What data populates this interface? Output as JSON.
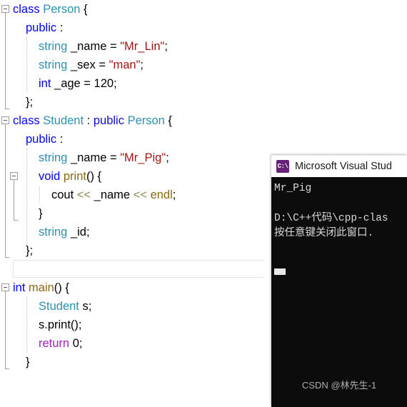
{
  "editor": {
    "language": "cpp",
    "lines": [
      {
        "indent": 0,
        "fold": "root-open",
        "tokens": [
          {
            "t": "class",
            "c": "kw"
          },
          {
            "t": " ",
            "c": "plain"
          },
          {
            "t": "Person",
            "c": "type"
          },
          {
            "t": " {",
            "c": "brace"
          }
        ]
      },
      {
        "indent": 1,
        "tokens": [
          {
            "t": "public",
            "c": "kw"
          },
          {
            "t": " :",
            "c": "plain"
          }
        ]
      },
      {
        "indent": 2,
        "tokens": [
          {
            "t": "string",
            "c": "type"
          },
          {
            "t": " _name = ",
            "c": "plain"
          },
          {
            "t": "\"Mr_Lin\"",
            "c": "str"
          },
          {
            "t": ";",
            "c": "plain"
          }
        ]
      },
      {
        "indent": 2,
        "tokens": [
          {
            "t": "string",
            "c": "type"
          },
          {
            "t": " _sex = ",
            "c": "plain"
          },
          {
            "t": "\"man\"",
            "c": "str"
          },
          {
            "t": ";",
            "c": "plain"
          }
        ]
      },
      {
        "indent": 2,
        "tokens": [
          {
            "t": "int",
            "c": "kw"
          },
          {
            "t": " _age = ",
            "c": "plain"
          },
          {
            "t": "120",
            "c": "num"
          },
          {
            "t": ";",
            "c": "plain"
          }
        ]
      },
      {
        "indent": 1,
        "tokens": [
          {
            "t": "};",
            "c": "brace"
          }
        ]
      },
      {
        "indent": 0,
        "fold": "root-open",
        "tokens": [
          {
            "t": "class",
            "c": "kw"
          },
          {
            "t": " ",
            "c": "plain"
          },
          {
            "t": "Student",
            "c": "type"
          },
          {
            "t": " : ",
            "c": "plain"
          },
          {
            "t": "public",
            "c": "kw2"
          },
          {
            "t": " ",
            "c": "plain"
          },
          {
            "t": "Person",
            "c": "type"
          },
          {
            "t": " {",
            "c": "brace"
          }
        ]
      },
      {
        "indent": 1,
        "tokens": [
          {
            "t": "public",
            "c": "kw"
          },
          {
            "t": " :",
            "c": "plain"
          }
        ]
      },
      {
        "indent": 2,
        "tokens": [
          {
            "t": "string",
            "c": "type"
          },
          {
            "t": " _name = ",
            "c": "plain"
          },
          {
            "t": "\"Mr_Pig\"",
            "c": "str"
          },
          {
            "t": ";",
            "c": "plain"
          }
        ]
      },
      {
        "indent": 2,
        "fold": "nested-open",
        "tokens": [
          {
            "t": "void",
            "c": "kw"
          },
          {
            "t": " ",
            "c": "plain"
          },
          {
            "t": "print",
            "c": "fn"
          },
          {
            "t": "() {",
            "c": "brace"
          }
        ]
      },
      {
        "indent": 3,
        "tokens": [
          {
            "t": "cout ",
            "c": "plain"
          },
          {
            "t": "<<",
            "c": "op"
          },
          {
            "t": " _name ",
            "c": "plain"
          },
          {
            "t": "<<",
            "c": "op"
          },
          {
            "t": " ",
            "c": "plain"
          },
          {
            "t": "endl",
            "c": "fn"
          },
          {
            "t": ";",
            "c": "plain"
          }
        ]
      },
      {
        "indent": 2,
        "tokens": [
          {
            "t": "}",
            "c": "brace"
          }
        ]
      },
      {
        "indent": 2,
        "tokens": [
          {
            "t": "string",
            "c": "type"
          },
          {
            "t": " _id;",
            "c": "plain"
          }
        ]
      },
      {
        "indent": 1,
        "tokens": [
          {
            "t": "};",
            "c": "brace"
          }
        ]
      },
      {
        "indent": 1,
        "blank": true,
        "current": true,
        "tokens": []
      },
      {
        "indent": 0,
        "fold": "root-open",
        "tokens": [
          {
            "t": "int",
            "c": "kw"
          },
          {
            "t": " ",
            "c": "plain"
          },
          {
            "t": "main",
            "c": "fn"
          },
          {
            "t": "() {",
            "c": "brace"
          }
        ]
      },
      {
        "indent": 2,
        "tokens": [
          {
            "t": "Student",
            "c": "type"
          },
          {
            "t": " s;",
            "c": "plain"
          }
        ]
      },
      {
        "indent": 2,
        "tokens": [
          {
            "t": "s.print();",
            "c": "plain"
          }
        ]
      },
      {
        "indent": 2,
        "tokens": [
          {
            "t": "return",
            "c": "ctrl"
          },
          {
            "t": " ",
            "c": "plain"
          },
          {
            "t": "0",
            "c": "num"
          },
          {
            "t": ";",
            "c": "plain"
          }
        ]
      },
      {
        "indent": 1,
        "tokens": [
          {
            "t": "}",
            "c": "brace"
          }
        ]
      }
    ]
  },
  "console": {
    "icon_glyph": "C:\\",
    "icon_name": "visual-studio-console-icon",
    "title": "Microsoft Visual Stud",
    "lines": [
      "Mr_Pig",
      "",
      "D:\\C++代码\\cpp-clas",
      "按任意键关闭此窗口."
    ],
    "watermark": "CSDN @林先生-1"
  },
  "colors": {
    "keyword": "#0000FF",
    "type": "#2B91AF",
    "string": "#A31515",
    "function": "#8B6914",
    "control": "#A020C0",
    "operator": "#8B8B50",
    "editor_background": "#FFFFFF",
    "console_background": "#0C0C0C",
    "console_text": "#D8D8D8",
    "titlebar_background": "#FFFFFF",
    "icon_background": "#68217A"
  }
}
